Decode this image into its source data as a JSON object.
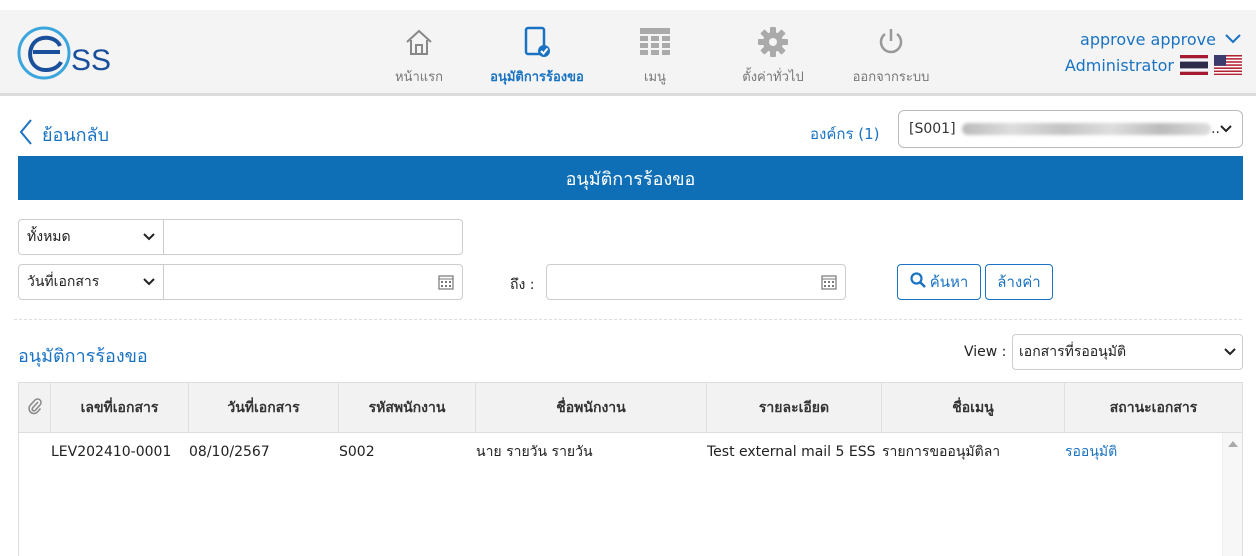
{
  "header": {
    "logo_text": "SS",
    "nav": [
      {
        "label": "หน้าแรก",
        "icon": "home-icon"
      },
      {
        "label": "อนุมัติการร้องขอ",
        "icon": "approve-document-icon"
      },
      {
        "label": "เมนู",
        "icon": "grid-menu-icon"
      },
      {
        "label": "ตั้งค่าทั่วไป",
        "icon": "gear-icon"
      },
      {
        "label": "ออกจากระบบ",
        "icon": "power-icon"
      }
    ],
    "active_nav": "อนุมัติการร้องขอ",
    "user_name": "approve approve",
    "user_role": "Administrator"
  },
  "subbar": {
    "back_label": "ย้อนกลับ",
    "org_label": "องค์กร (1)",
    "org_value": "[S001]",
    "org_suffix": ".."
  },
  "title": "อนุมัติการร้องขอ",
  "filters": {
    "type_select": "ทั้งหมด",
    "keyword_value": "",
    "date_type_select": "วันที่เอกสาร",
    "date_from": "",
    "to_label": "ถึง :",
    "date_to": "",
    "search_button": "ค้นหา",
    "clear_button": "ล้างค่า"
  },
  "list": {
    "section_title": "อนุมัติการร้องขอ",
    "view_label": "View :",
    "view_select": "เอกสารที่รออนุมัติ"
  },
  "table": {
    "columns": [
      "เลขที่เอกสาร",
      "วันที่เอกสาร",
      "รหัสพนักงาน",
      "ชื่อพนักงาน",
      "รายละเอียด",
      "ชื่อเมนู",
      "สถานะเอกสาร"
    ],
    "rows": [
      {
        "doc_no": "LEV202410-0001",
        "doc_date": "08/10/2567",
        "emp_code": "S002",
        "emp_name": "นาย รายวัน รายวัน",
        "detail": "Test external mail 5 ESS",
        "menu_name": "รายการขออนุมัติลา",
        "status": "รออนุมัติ"
      }
    ]
  },
  "colors": {
    "primary": "#0f6fb6",
    "link": "#1a73c2",
    "header_bg": "#f4f4f4"
  }
}
